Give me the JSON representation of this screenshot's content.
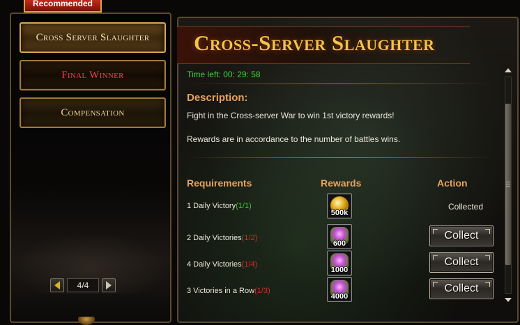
{
  "recommended_tab": "Recommended",
  "menu": {
    "items": [
      {
        "label": "Cross Server Slaughter"
      },
      {
        "label": "Final Winner"
      },
      {
        "label": "Compensation"
      }
    ],
    "colors": {
      "active": "#f4e2b8",
      "final_winner": "#ff3a4a",
      "compensation": "#f0d38a"
    }
  },
  "pager": {
    "text": "4/4"
  },
  "panel": {
    "title": "Cross-Server Slaughter",
    "time_left": "Time left: 00: 29: 58",
    "description_heading": "Description:",
    "description_line1": "Fight in the Cross-server War to win 1st victory rewards!",
    "description_line2": "Rewards are in accordance to the number of battles wins."
  },
  "columns": {
    "requirements": "Requirements",
    "rewards": "Rewards",
    "action": "Action"
  },
  "rows": [
    {
      "requirement": "1 Daily Victory",
      "progress": "(1/1)",
      "reward": "500k",
      "action": "Collected"
    },
    {
      "requirement": "2 Daily Victories",
      "progress": "(1/2)",
      "reward": "600",
      "action": "Collect"
    },
    {
      "requirement": "4 Daily Victories",
      "progress": "(1/4)",
      "reward": "1000",
      "action": "Collect"
    },
    {
      "requirement": "3 Victories in a Row",
      "progress": "(1/3)",
      "reward": "4000",
      "action": "Collect"
    }
  ],
  "colors": {
    "accent_orange": "#e7a35b",
    "title_gold": "#f2c34a",
    "progress_ok": "#37c437",
    "progress_incomplete": "#d42a2a",
    "timer_green": "#3fd33f"
  }
}
